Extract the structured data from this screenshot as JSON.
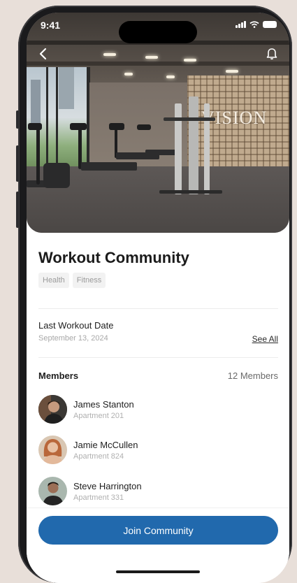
{
  "status_bar": {
    "time": "9:41"
  },
  "hero": {
    "wall_sign": "VISION",
    "back_icon": "chevron-left-icon",
    "notify_icon": "bell-icon"
  },
  "community": {
    "title": "Workout Community",
    "tags": [
      "Health",
      "Fitness"
    ]
  },
  "last_workout": {
    "label": "Last Workout Date",
    "date": "September 13, 2024",
    "see_all": "See All"
  },
  "members": {
    "label": "Members",
    "count": "12 Members",
    "list": [
      {
        "name": "James Stanton",
        "apartment": "Apartment 201"
      },
      {
        "name": "Jamie McCullen",
        "apartment": "Apartment 824"
      },
      {
        "name": "Steve Harrington",
        "apartment": "Apartment 331"
      }
    ]
  },
  "actions": {
    "join": "Join Community"
  },
  "colors": {
    "accent": "#2169ad",
    "background": "#e8dfd9"
  }
}
